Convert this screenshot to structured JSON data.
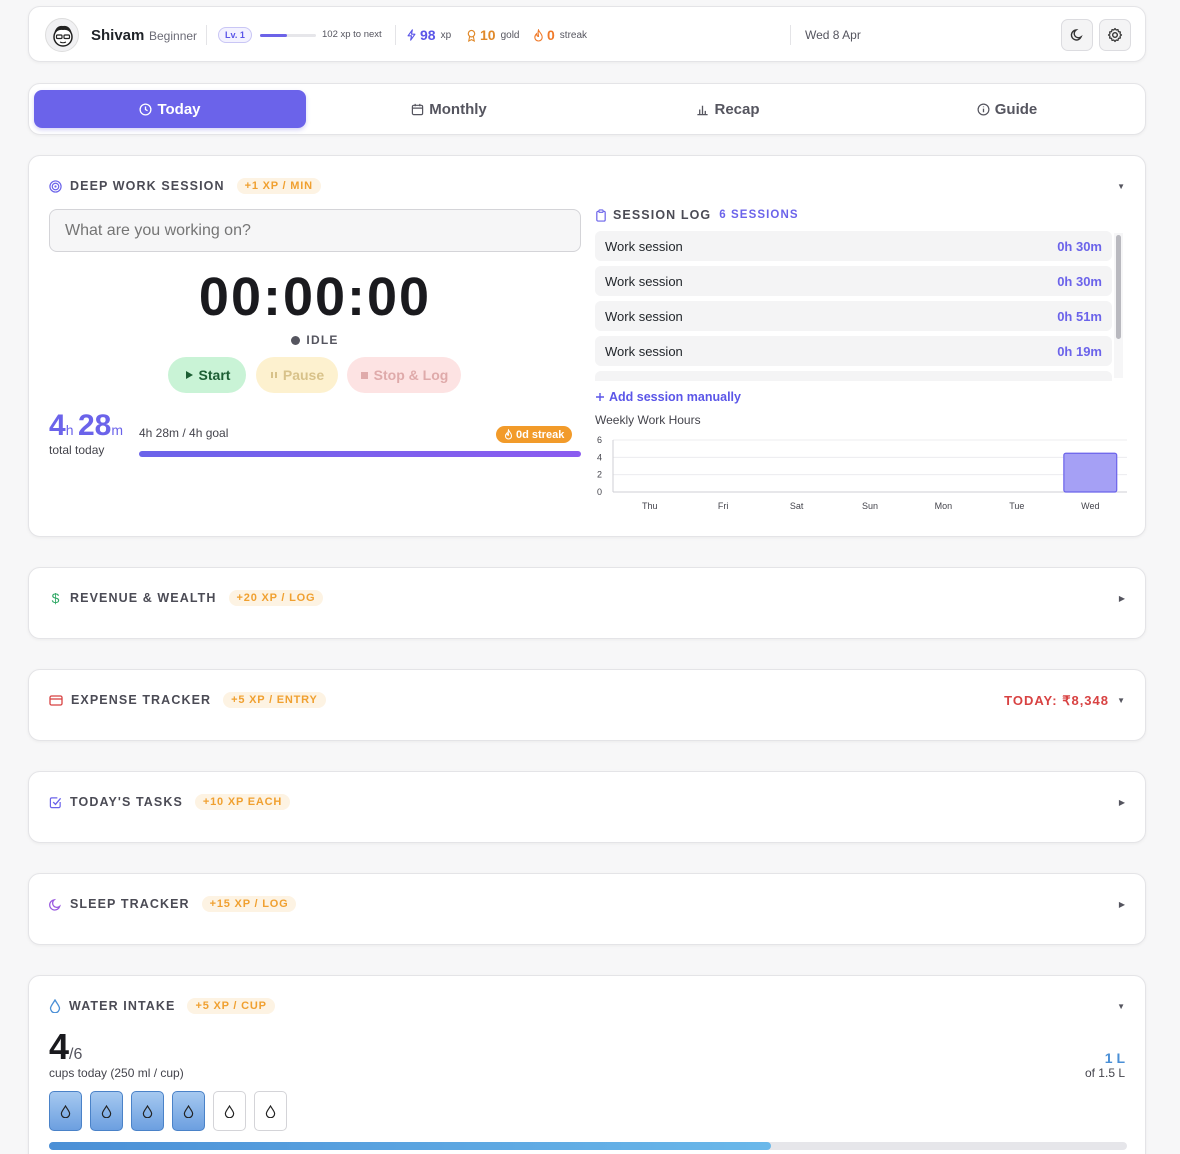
{
  "user": {
    "name": "Shivam",
    "rank": "Beginner",
    "level": "Lv. 1",
    "xp_to_next": "102 xp to next",
    "xp_progress": 0.49
  },
  "stats": {
    "xp": {
      "value": "98",
      "unit": "xp"
    },
    "gold": {
      "value": "10",
      "unit": "gold"
    },
    "streak": {
      "value": "0",
      "unit": "streak"
    }
  },
  "date": "Wed 8 Apr",
  "tabs": [
    "Today",
    "Monthly",
    "Recap",
    "Guide"
  ],
  "active_tab": "Today",
  "deep_work": {
    "title": "DEEP WORK SESSION",
    "xp_badge": "+1 XP / MIN",
    "input_placeholder": "What are you working on?",
    "timer": "00:00:00",
    "status": "IDLE",
    "buttons": {
      "start": "Start",
      "pause": "Pause",
      "stop": "Stop & Log"
    },
    "total_hours": "4",
    "total_h_unit": "h",
    "total_minutes": "28",
    "total_m_unit": "m",
    "total_label": "total today",
    "goal_text": "4h 28m / 4h goal",
    "goal_progress": 1.0,
    "streak_badge": "0d streak",
    "session_log": {
      "title": "SESSION LOG",
      "count": "6 SESSIONS",
      "items": [
        {
          "name": "Work session",
          "duration": "0h 30m"
        },
        {
          "name": "Work session",
          "duration": "0h 30m"
        },
        {
          "name": "Work session",
          "duration": "0h 51m"
        },
        {
          "name": "Work session",
          "duration": "0h 19m"
        }
      ],
      "add_manual": "Add session manually"
    }
  },
  "weekly_chart_title": "Weekly Work Hours",
  "chart_data": {
    "type": "bar",
    "title": "Weekly Work Hours",
    "categories": [
      "Thu",
      "Fri",
      "Sat",
      "Sun",
      "Mon",
      "Tue",
      "Wed"
    ],
    "values": [
      0,
      0,
      0,
      0,
      0,
      0,
      4.47
    ],
    "yticks": [
      "0",
      "2",
      "4",
      "6"
    ],
    "ylim": [
      0,
      6
    ],
    "grid": true,
    "bar_color": "#a5a0f5"
  },
  "revenue": {
    "title": "REVENUE & WEALTH",
    "xp_badge": "+20 XP / LOG"
  },
  "expense": {
    "title": "EXPENSE TRACKER",
    "xp_badge": "+5 XP / ENTRY",
    "today": "TODAY: ₹8,348"
  },
  "tasks": {
    "title": "TODAY'S TASKS",
    "xp_badge": "+10 XP EACH"
  },
  "sleep": {
    "title": "SLEEP TRACKER",
    "xp_badge": "+15 XP / LOG"
  },
  "water": {
    "title": "WATER INTAKE",
    "xp_badge": "+5 XP / CUP",
    "cups": "4",
    "goal": "/6",
    "label": "cups today (250 ml / cup)",
    "liters": "1 L",
    "of_liters": "of 1.5 L",
    "cups_filled": 4,
    "cups_total": 6,
    "progress": 0.67
  },
  "colors": {
    "accent": "#6b63ea",
    "xp_badge": "#f0a030",
    "expense": "#d84242",
    "water": "#4a8fd6"
  }
}
